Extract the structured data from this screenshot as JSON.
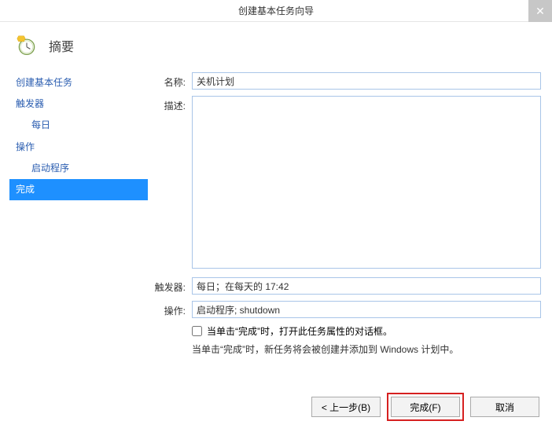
{
  "window": {
    "title": "创建基本任务向导"
  },
  "header": {
    "title": "摘要"
  },
  "sidebar": {
    "items": [
      {
        "label": "创建基本任务",
        "indent": false
      },
      {
        "label": "触发器",
        "indent": false
      },
      {
        "label": "每日",
        "indent": true
      },
      {
        "label": "操作",
        "indent": false
      },
      {
        "label": "启动程序",
        "indent": true
      },
      {
        "label": "完成",
        "indent": false,
        "active": true
      }
    ]
  },
  "form": {
    "name_label": "名称:",
    "name_value": "关机计划",
    "desc_label": "描述:",
    "desc_value": "",
    "trigger_label": "触发器:",
    "trigger_value": "每日；在每天的 17:42",
    "action_label": "操作:",
    "action_value": "启动程序; shutdown",
    "checkbox_label": "当单击“完成”时，打开此任务属性的对话框。",
    "hint": "当单击“完成”时，新任务将会被创建并添加到 Windows 计划中。"
  },
  "buttons": {
    "back": "< 上一步(B)",
    "finish": "完成(F)",
    "cancel": "取消"
  }
}
